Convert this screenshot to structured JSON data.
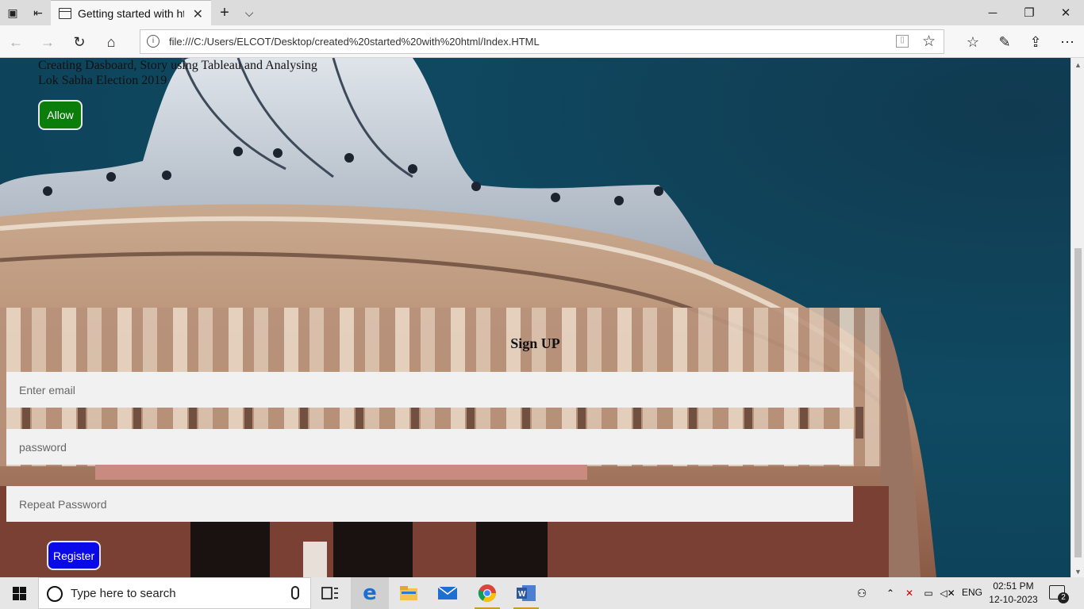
{
  "browser": {
    "tab_title": "Getting started with htm",
    "url": "file:///C:/Users/ELCOT/Desktop/created%20started%20with%20html/Index.HTML"
  },
  "page": {
    "intro_text": "Creating Dasboard, Story using Tableau and Analysing Lok Sabha Election 2019",
    "allow_label": "Allow",
    "signup_title": "Sign UP",
    "email_placeholder": "Enter email",
    "password_placeholder": "password",
    "repeat_placeholder": "Repeat Password",
    "register_label": "Register"
  },
  "taskbar": {
    "search_placeholder": "Type here to search",
    "language": "ENG",
    "time": "02:51 PM",
    "date": "12-10-2023",
    "notification_count": "2"
  },
  "colors": {
    "allow_button": "#0a7d0a",
    "register_button": "#0a0ae8",
    "page_background": "#0f4a62"
  }
}
